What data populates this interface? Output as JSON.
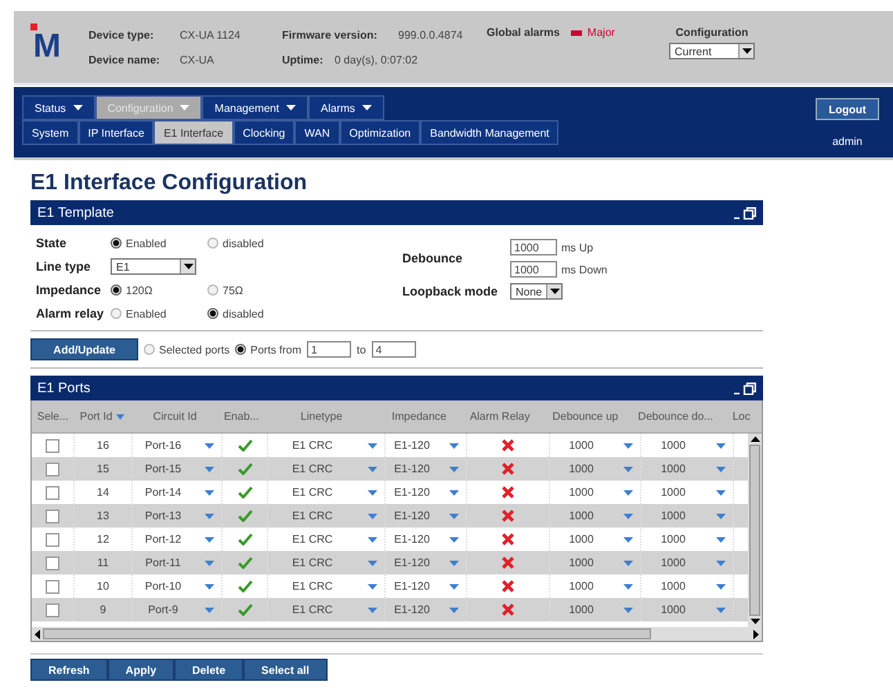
{
  "header": {
    "logo": "M",
    "device_type_label": "Device type:",
    "device_type": "CX-UA 1124",
    "device_name_label": "Device name:",
    "device_name": "CX-UA",
    "firmware_label": "Firmware version:",
    "firmware": "999.0.0.4874",
    "uptime_label": "Uptime:",
    "uptime": "0 day(s), 0:07:02",
    "alarms_label": "Global alarms",
    "alarm": {
      "text": "Major",
      "color": "#cc0033"
    },
    "config_label": "Configuration",
    "config_value": "Current"
  },
  "nav": {
    "menus": [
      {
        "label": "Status",
        "selected": false
      },
      {
        "label": "Configuration",
        "selected": true
      },
      {
        "label": "Management",
        "selected": false
      },
      {
        "label": "Alarms",
        "selected": false
      }
    ],
    "submenu": [
      {
        "label": "System",
        "selected": false
      },
      {
        "label": "IP Interface",
        "selected": false
      },
      {
        "label": "E1 Interface",
        "selected": true
      },
      {
        "label": "Clocking",
        "selected": false
      },
      {
        "label": "WAN",
        "selected": false
      },
      {
        "label": "Optimization",
        "selected": false
      },
      {
        "label": "Bandwidth Management",
        "selected": false
      }
    ],
    "logout": "Logout",
    "user": "admin"
  },
  "page_title": "E1 Interface Configuration",
  "template": {
    "title": "E1 Template",
    "state": {
      "label": "State",
      "options": [
        {
          "label": "Enabled",
          "selected": true
        },
        {
          "label": "disabled",
          "selected": false
        }
      ]
    },
    "line_type": {
      "label": "Line type",
      "value": "E1"
    },
    "impedance": {
      "label": "Impedance",
      "options": [
        {
          "label": "120Ω",
          "selected": true
        },
        {
          "label": "75Ω",
          "selected": false
        }
      ]
    },
    "alarm_relay": {
      "label": "Alarm relay",
      "options": [
        {
          "label": "Enabled",
          "selected": false
        },
        {
          "label": "disabled",
          "selected": true
        }
      ]
    },
    "debounce": {
      "label": "Debounce",
      "up_value": "1000",
      "up_unit": "ms Up",
      "down_value": "1000",
      "down_unit": "ms Down"
    },
    "loopback": {
      "label": "Loopback mode",
      "value": "None"
    }
  },
  "apply_bar": {
    "button": "Add/Update",
    "options": [
      {
        "label": "Selected ports",
        "selected": false
      },
      {
        "label": "Ports from",
        "selected": true
      }
    ],
    "from": "1",
    "to_label": "to",
    "to": "4"
  },
  "ports": {
    "title": "E1 Ports",
    "columns": [
      {
        "label": "Sele...",
        "sorted": false
      },
      {
        "label": "Port Id",
        "sorted": true
      },
      {
        "label": "Circuit Id",
        "sorted": false
      },
      {
        "label": "Enab...",
        "sorted": false
      },
      {
        "label": "Linetype",
        "sorted": false
      },
      {
        "label": "Impedance",
        "sorted": false
      },
      {
        "label": "Alarm Relay",
        "sorted": false
      },
      {
        "label": "Debounce up",
        "sorted": false
      },
      {
        "label": "Debounce do...",
        "sorted": false
      },
      {
        "label": "Loc",
        "sorted": false
      }
    ],
    "rows": [
      {
        "selected": false,
        "port_id": "16",
        "circuit_id": "Port-16",
        "enabled": true,
        "linetype": "E1 CRC",
        "impedance": "E1-120",
        "alarm_relay": false,
        "debounce_up": "1000",
        "debounce_down": "1000"
      },
      {
        "selected": false,
        "port_id": "15",
        "circuit_id": "Port-15",
        "enabled": true,
        "linetype": "E1 CRC",
        "impedance": "E1-120",
        "alarm_relay": false,
        "debounce_up": "1000",
        "debounce_down": "1000"
      },
      {
        "selected": false,
        "port_id": "14",
        "circuit_id": "Port-14",
        "enabled": true,
        "linetype": "E1 CRC",
        "impedance": "E1-120",
        "alarm_relay": false,
        "debounce_up": "1000",
        "debounce_down": "1000"
      },
      {
        "selected": false,
        "port_id": "13",
        "circuit_id": "Port-13",
        "enabled": true,
        "linetype": "E1 CRC",
        "impedance": "E1-120",
        "alarm_relay": false,
        "debounce_up": "1000",
        "debounce_down": "1000"
      },
      {
        "selected": false,
        "port_id": "12",
        "circuit_id": "Port-12",
        "enabled": true,
        "linetype": "E1 CRC",
        "impedance": "E1-120",
        "alarm_relay": false,
        "debounce_up": "1000",
        "debounce_down": "1000"
      },
      {
        "selected": false,
        "port_id": "11",
        "circuit_id": "Port-11",
        "enabled": true,
        "linetype": "E1 CRC",
        "impedance": "E1-120",
        "alarm_relay": false,
        "debounce_up": "1000",
        "debounce_down": "1000"
      },
      {
        "selected": false,
        "port_id": "10",
        "circuit_id": "Port-10",
        "enabled": true,
        "linetype": "E1 CRC",
        "impedance": "E1-120",
        "alarm_relay": false,
        "debounce_up": "1000",
        "debounce_down": "1000"
      },
      {
        "selected": false,
        "port_id": "9",
        "circuit_id": "Port-9",
        "enabled": true,
        "linetype": "E1 CRC",
        "impedance": "E1-120",
        "alarm_relay": false,
        "debounce_up": "1000",
        "debounce_down": "1000"
      }
    ]
  },
  "buttons": [
    "Refresh",
    "Apply",
    "Delete",
    "Select all"
  ]
}
